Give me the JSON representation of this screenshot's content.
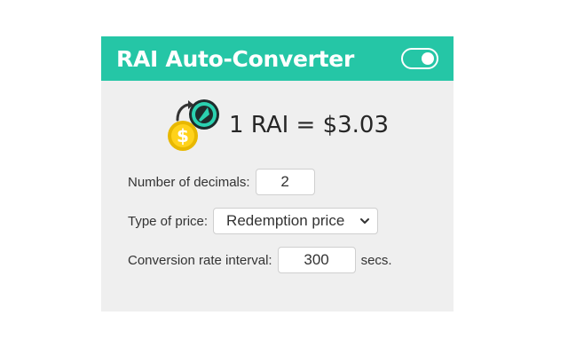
{
  "header": {
    "title": "RAI Auto-Converter",
    "toggle_on": true,
    "accent_color": "#25c6a6"
  },
  "rate": {
    "text": "1 RAI = $3.03",
    "icon": "rai-dollar-coins-icon"
  },
  "settings": {
    "decimals_label": "Number of decimals:",
    "decimals_value": "2",
    "price_type_label": "Type of price:",
    "price_type_value": "Redemption price",
    "interval_label": "Conversion rate interval:",
    "interval_value": "300",
    "interval_unit": "secs."
  }
}
